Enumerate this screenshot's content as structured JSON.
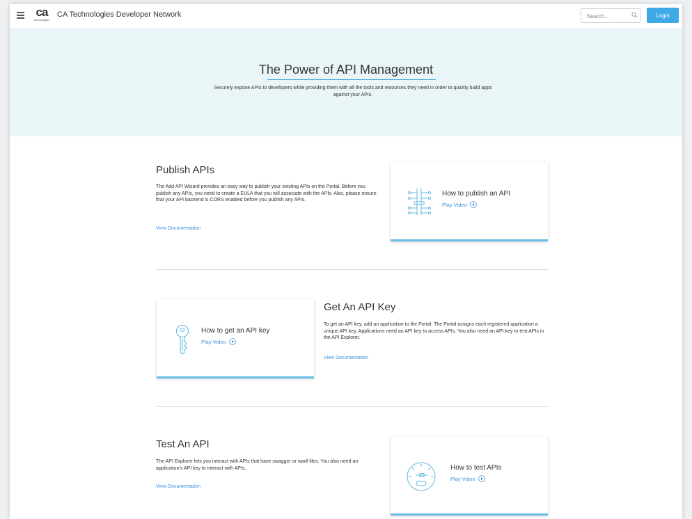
{
  "header": {
    "logo_text": "ca",
    "logo_sub": "technologies",
    "app_title": "CA Technologies Developer Network",
    "search_placeholder": "Search...",
    "login_label": "Login"
  },
  "hero": {
    "title": "The Power of API Management",
    "subtitle": "Securely expose APIs to developers while providing them with all the tools and resources they need in order to quickly build apps against your APIs."
  },
  "sections": [
    {
      "title": "Publish APIs",
      "text": "The Add API Wizard provides an easy way to publish your existing APIs on the Portal. Before you publish any APIs, you need to create a EULA that you will associate with the APIs. Also, please ensure that your API backend is CORS enabled before you publish any APIs.",
      "link": "View Documentation",
      "card_title": "How to publish an API",
      "card_play": "Play Video",
      "card_icon": "circuit-icon"
    },
    {
      "title": "Get An API Key",
      "text": "To get an API key, add an application to the Portal. The Portal assigns each registered application a unique API key. Applications need an API key to access APIs. You also need an API key to test APIs in the API Explorer.",
      "link": "View Documentation",
      "card_title": "How to get an API key",
      "card_play": "Play Video",
      "card_icon": "key-icon"
    },
    {
      "title": "Test An API",
      "text": "The API Explorer lets you interact with APIs that have swagger or wadl files. You also need an application's API key to interact with APIs.",
      "link": "View Documentation",
      "card_title": "How to test APIs",
      "card_play": "Play Video",
      "card_icon": "gauge-icon"
    }
  ],
  "colors": {
    "accent": "#3fa9e8",
    "link": "#3a8fd6",
    "hero_bg": "#eaf5f8",
    "card_border": "#67bde6"
  }
}
